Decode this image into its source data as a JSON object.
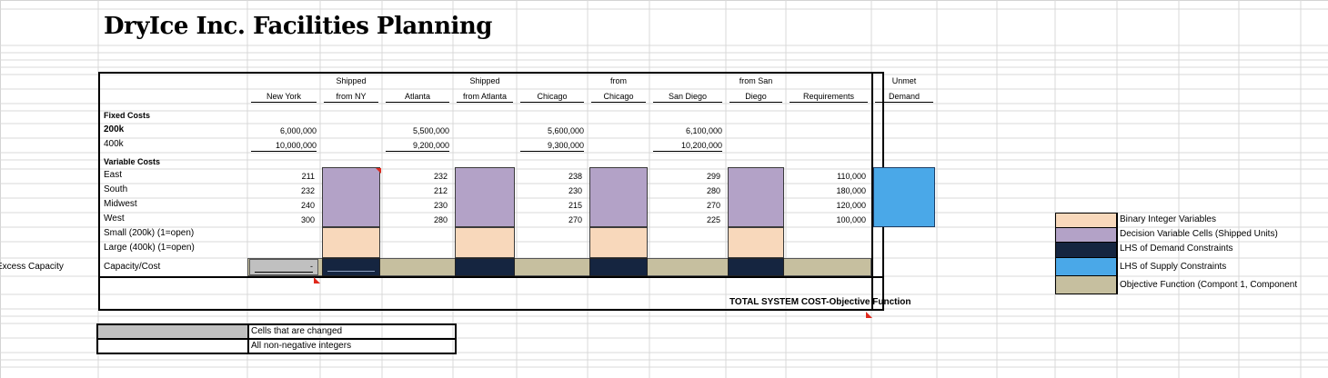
{
  "sheet": {
    "title": "DryIce Inc. Facilities Planning",
    "side_label": "Excess Capacity"
  },
  "header": {
    "new_york": "New York",
    "shipped_ny_1": "Shipped",
    "shipped_ny_2": "from NY",
    "atlanta": "Atlanta",
    "shipped_atl_1": "Shipped",
    "shipped_atl_2": "from Atlanta",
    "chicago": "Chicago",
    "from_chicago_1": "from",
    "from_chicago_2": "Chicago",
    "san_diego": "San Diego",
    "from_sd_1": "from San",
    "from_sd_2": "Diego",
    "requirements": "Requirements",
    "unmet_1": "Unmet",
    "unmet_2": "Demand"
  },
  "fixed": {
    "label": "Fixed Costs",
    "r200_label": "200k",
    "r400_label": "400k",
    "ny_200": "6,000,000",
    "ny_400": "10,000,000",
    "atl_200": "5,500,000",
    "atl_400": "9,200,000",
    "chi_200": "5,600,000",
    "chi_400": "9,300,000",
    "sd_200": "6,100,000",
    "sd_400": "10,200,000"
  },
  "variable": {
    "label": "Variable Costs",
    "rows": [
      {
        "region": "East",
        "ny": "211",
        "atl": "232",
        "chi": "238",
        "sd": "299",
        "req": "110,000"
      },
      {
        "region": "South",
        "ny": "232",
        "atl": "212",
        "chi": "230",
        "sd": "280",
        "req": "180,000"
      },
      {
        "region": "Midwest",
        "ny": "240",
        "atl": "230",
        "chi": "215",
        "sd": "270",
        "req": "120,000"
      },
      {
        "region": "West",
        "ny": "300",
        "atl": "280",
        "chi": "270",
        "sd": "225",
        "req": "100,000"
      }
    ],
    "small_label": "Small (200k) (1=open)",
    "large_label": "Large (400k) (1=open)",
    "capacity_label": "Capacity/Cost",
    "capacity_value": "-"
  },
  "objective": {
    "label": "TOTAL SYSTEM COST-Objective Function"
  },
  "notes": {
    "changed": "Cells that are changed",
    "integers": "All non-negative integers"
  },
  "legend": [
    {
      "label": "Binary Integer Variables",
      "color": "#f8d8bb"
    },
    {
      "label": "Decision Variable Cells (Shipped Units)",
      "color": "#b3a2c7"
    },
    {
      "label": "LHS of Demand Constraints",
      "color": "#152540"
    },
    {
      "label": "LHS of Supply Constraints",
      "color": "#4aa8e8"
    },
    {
      "label": "Objective Function (Compont 1, Component",
      "color": "#c6bf9f"
    }
  ]
}
